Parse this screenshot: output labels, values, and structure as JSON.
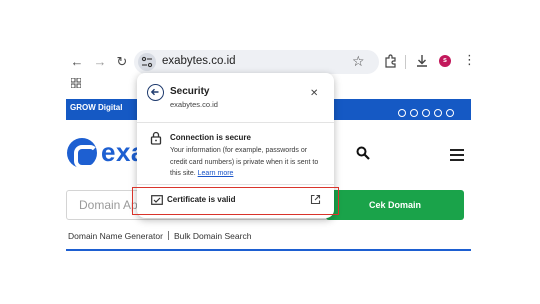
{
  "browser": {
    "url": "exabytes.co.id",
    "avatar_letter": "s",
    "avatar_color": "#c2185b"
  },
  "page": {
    "topbar_label": "GROW Digital",
    "brand_color": "#1d5fd1",
    "logo_text": "exa",
    "domain_placeholder": "Domain Apay",
    "search_button": "Cek Domain",
    "search_button_color": "#1aa34a",
    "links": [
      "Domain Name Generator",
      "Bulk Domain Search"
    ]
  },
  "security_popup": {
    "title": "Security",
    "subtitle": "exabytes.co.id",
    "connection_title": "Connection is secure",
    "connection_desc": "Your information (for example, passwords or credit card numbers) is private when it is sent to this site.",
    "learn_more": "Learn more",
    "certificate_label": "Certificate is valid",
    "highlight_color": "#d9342b"
  }
}
